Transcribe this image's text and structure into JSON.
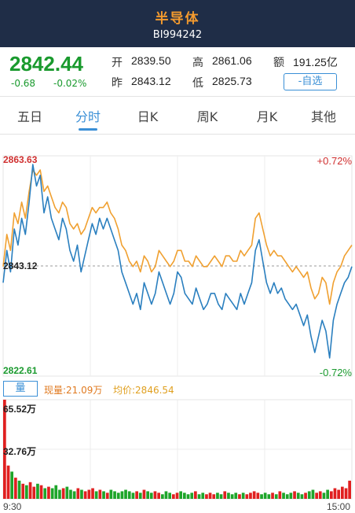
{
  "header": {
    "title": "半导体",
    "code": "BI994242"
  },
  "quote": {
    "price": "2842.44",
    "change": "-0.68",
    "change_pct": "-0.02%",
    "open_label": "开",
    "open": "2839.50",
    "high_label": "高",
    "high": "2861.06",
    "amount_label": "额",
    "amount": "191.25亿",
    "prev_label": "昨",
    "prev": "2843.12",
    "low_label": "低",
    "low": "2825.73",
    "watch_label": "-自选"
  },
  "tabs": [
    {
      "label": "五日"
    },
    {
      "label": "分时"
    },
    {
      "label": "日K"
    },
    {
      "label": "周K"
    },
    {
      "label": "月K"
    },
    {
      "label": "其他"
    }
  ],
  "active_tab": "分时",
  "chart": {
    "y_max_label": "2863.63",
    "y_mid_label": "2843.12",
    "y_min_label": "2822.61",
    "pct_max_label": "+0.72%",
    "pct_min_label": "-0.72%",
    "volume_button": "量",
    "current_volume": "现量:21.09万",
    "avg_price": "均价:2846.54",
    "vol_max_label": "65.52万",
    "vol_mid_label": "32.76万",
    "time_start": "9:30",
    "time_end": "15:00",
    "colors": {
      "price": "#2a7fbf",
      "avg": "#f0a030",
      "up": "#e02020",
      "down": "#1ea52a"
    }
  },
  "chart_data": {
    "type": "line",
    "ylim": [
      2822.61,
      2863.63
    ],
    "reference": 2843.12,
    "x": [
      "9:30",
      "15:00"
    ],
    "series": [
      {
        "name": "",
        "values": [
          2840,
          2846,
          2842,
          2850,
          2847,
          2852,
          2849,
          2855,
          2862,
          2858,
          2860,
          2853,
          2856,
          2852,
          2850,
          2848,
          2852,
          2850,
          2846,
          2844,
          2847,
          2842,
          2845,
          2848,
          2851,
          2849,
          2852,
          2850,
          2852,
          2850,
          2848,
          2846,
          2842,
          2840,
          2838,
          2836,
          2838,
          2835,
          2840,
          2838,
          2836,
          2838,
          2842,
          2840,
          2838,
          2836,
          2838,
          2842,
          2841,
          2838,
          2837,
          2836,
          2839,
          2837,
          2835,
          2836,
          2838,
          2838,
          2836,
          2835,
          2838,
          2837,
          2836,
          2835,
          2838,
          2836,
          2838,
          2840,
          2846,
          2848,
          2844,
          2840,
          2838,
          2840,
          2838,
          2839,
          2837,
          2836,
          2835,
          2836,
          2834,
          2832,
          2834,
          2830,
          2827,
          2830,
          2833,
          2831,
          2826,
          2833,
          2836,
          2838,
          2840,
          2841,
          2843
        ]
      },
      {
        "name": "",
        "values": [
          2843,
          2849,
          2846,
          2853,
          2851,
          2855,
          2852,
          2857,
          2861,
          2860,
          2861,
          2857,
          2858,
          2856,
          2854,
          2853,
          2855,
          2854,
          2851,
          2850,
          2851,
          2849,
          2850,
          2852,
          2854,
          2853,
          2854,
          2854,
          2855,
          2853,
          2852,
          2850,
          2847,
          2846,
          2844,
          2843,
          2844,
          2842,
          2845,
          2844,
          2842,
          2843,
          2846,
          2845,
          2844,
          2843,
          2844,
          2846,
          2846,
          2844,
          2844,
          2843,
          2845,
          2844,
          2843,
          2843,
          2844,
          2845,
          2844,
          2843,
          2845,
          2845,
          2844,
          2844,
          2846,
          2845,
          2846,
          2847,
          2852,
          2853,
          2850,
          2847,
          2845,
          2846,
          2845,
          2845,
          2844,
          2843,
          2842,
          2843,
          2842,
          2841,
          2842,
          2839,
          2837,
          2838,
          2841,
          2840,
          2836,
          2840,
          2842,
          2843,
          2845,
          2846,
          2847
        ]
      }
    ],
    "volume": [
      65.5,
      22,
      18,
      14,
      12,
      10,
      9,
      11,
      8,
      10,
      9,
      7,
      8,
      7,
      9,
      6,
      7,
      8,
      6,
      5,
      7,
      6,
      5,
      6,
      7,
      5,
      6,
      5,
      4,
      6,
      5,
      4,
      5,
      6,
      5,
      4,
      5,
      4,
      6,
      5,
      4,
      5,
      4,
      3,
      5,
      4,
      3,
      4,
      5,
      4,
      3,
      4,
      5,
      3,
      4,
      3,
      4,
      3,
      4,
      3,
      5,
      4,
      3,
      4,
      3,
      4,
      3,
      4,
      5,
      4,
      3,
      4,
      3,
      4,
      3,
      5,
      4,
      3,
      4,
      5,
      4,
      3,
      4,
      5,
      6,
      4,
      5,
      4,
      6,
      5,
      7,
      6,
      8,
      7,
      12
    ],
    "volume_ylim": [
      0,
      65.52
    ]
  }
}
